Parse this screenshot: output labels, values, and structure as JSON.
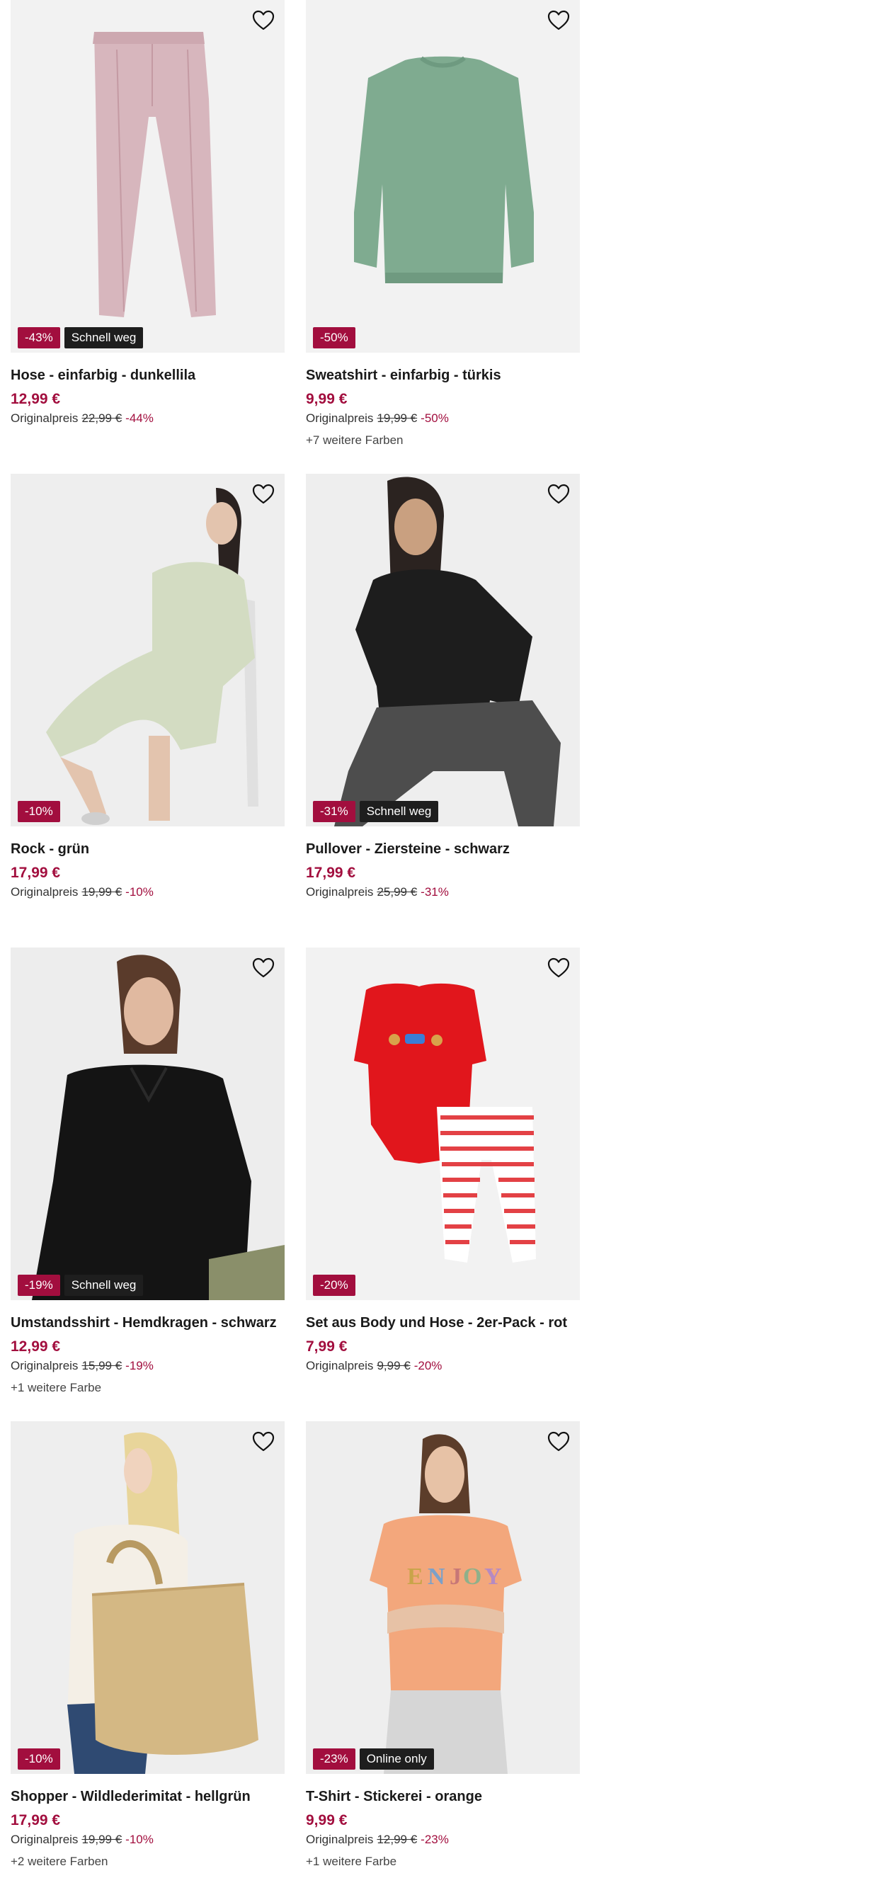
{
  "products": [
    {
      "name": "Hose - einfarbig - dunkellila",
      "price": "12,99 €",
      "original_label": "Originalpreis",
      "original_price": "22,99 €",
      "savings": "-44%",
      "badge_discount": "-43%",
      "badge_tag": "Schnell weg",
      "colors": "",
      "image": "lilac-pants",
      "image_bg": "#f2f2f2"
    },
    {
      "name": "Sweatshirt - einfarbig - türkis",
      "price": "9,99 €",
      "original_label": "Originalpreis",
      "original_price": "19,99 €",
      "savings": "-50%",
      "badge_discount": "-50%",
      "badge_tag": "",
      "colors": "+7 weitere Farben",
      "image": "green-sweatshirt",
      "image_bg": "#f2f2f2"
    },
    {
      "name": "Rock - grün",
      "price": "17,99 €",
      "original_label": "Originalpreis",
      "original_price": "19,99 €",
      "savings": "-10%",
      "badge_discount": "-10%",
      "badge_tag": "",
      "colors": "",
      "image": "model-green-knit",
      "image_bg": "#eeeeee"
    },
    {
      "name": "Pullover - Ziersteine - schwarz",
      "price": "17,99 €",
      "original_label": "Originalpreis",
      "original_price": "25,99 €",
      "savings": "-31%",
      "badge_discount": "-31%",
      "badge_tag": "Schnell weg",
      "colors": "",
      "image": "model-black-pullover",
      "image_bg": "#eeeeee"
    },
    {
      "name": "Umstandsshirt - Hemdkragen - schwarz",
      "price": "12,99 €",
      "original_label": "Originalpreis",
      "original_price": "15,99 €",
      "savings": "-19%",
      "badge_discount": "-19%",
      "badge_tag": "Schnell weg",
      "colors": "+1 weitere Farbe",
      "image": "model-black-shirt",
      "image_bg": "#ededed"
    },
    {
      "name": "Set aus Body und Hose - 2er-Pack - rot",
      "price": "7,99 €",
      "original_label": "Originalpreis",
      "original_price": "9,99 €",
      "savings": "-20%",
      "badge_discount": "-20%",
      "badge_tag": "",
      "colors": "",
      "image": "red-baby-set",
      "image_bg": "#f2f2f2"
    },
    {
      "name": "Shopper - Wildlederimitat - hellgrün",
      "price": "17,99 €",
      "original_label": "Originalpreis",
      "original_price": "19,99 €",
      "savings": "-10%",
      "badge_discount": "-10%",
      "badge_tag": "",
      "colors": "+2 weitere Farben",
      "image": "model-shopper-bag",
      "image_bg": "#eeeeee"
    },
    {
      "name": "T-Shirt - Stickerei - orange",
      "price": "9,99 €",
      "original_label": "Originalpreis",
      "original_price": "12,99 €",
      "savings": "-23%",
      "badge_discount": "-23%",
      "badge_tag": "Online only",
      "colors": "+1 weitere Farbe",
      "image": "model-orange-tshirt",
      "image_bg": "#eeeeee"
    }
  ],
  "icons": {
    "wishlist": "heart-outline-icon"
  },
  "colors": {
    "accent": "#a20e3e",
    "tag": "#1e1e1e",
    "text": "#1a1a1a"
  }
}
